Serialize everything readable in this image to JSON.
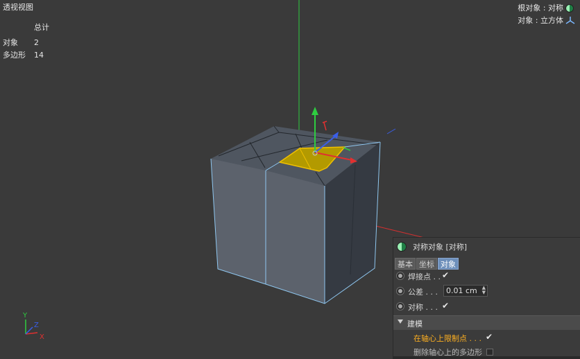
{
  "viewport": {
    "title": "透视视图",
    "stats": {
      "header": "总计",
      "rows": [
        {
          "label": "对象",
          "value": "2"
        },
        {
          "label": "多边形",
          "value": "14"
        }
      ]
    },
    "root_object": "根对象 : 对称",
    "active_object": "对象 : 立方体",
    "axis_labels": {
      "y": "Y",
      "z": "Z",
      "x": "X"
    }
  },
  "panel": {
    "title": "对称对象 [对称]",
    "tabs": [
      {
        "label": "基本",
        "active": false
      },
      {
        "label": "坐标",
        "active": false
      },
      {
        "label": "对象",
        "active": true
      }
    ],
    "weld_label": "焊接点 . .",
    "tolerance_label": "公差 . . .",
    "tolerance_value": "0.01 cm",
    "symmetry_label": "对称 . . .",
    "group_label": "建模",
    "clamp_label": "在轴心上限制点 . . .",
    "delete_label": "删除轴心上的多边形",
    "check_mark": "✔"
  },
  "colors": {
    "background": "#3a3a3a",
    "selection": "#e2c000",
    "edge_highlight": "#8fc7f0",
    "axis_x": "#e03030",
    "axis_y": "#2ecc40",
    "axis_z": "#3a5ee8",
    "tab_active": "#6d8fba"
  }
}
